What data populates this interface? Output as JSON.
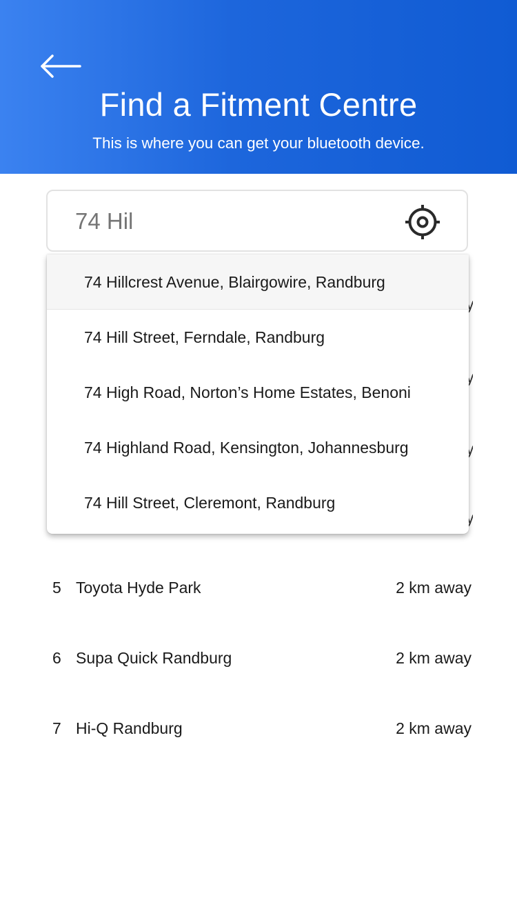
{
  "header": {
    "title": "Find a Fitment Centre",
    "subtitle": "This is where you can get your bluetooth device.",
    "gradient_colors": [
      "#3b82f0",
      "#105bd3"
    ],
    "back_icon": "arrow-left-icon"
  },
  "search": {
    "value": "",
    "placeholder": "74 Hil",
    "locate_icon": "crosshair-location-icon"
  },
  "suggestions": [
    "74 Hillcrest Avenue, Blairgowire, Randburg",
    "74 Hill Street, Ferndale, Randburg",
    "74 High Road, Norton’s Home Estates, Benoni",
    "74 Highland Road, Kensington, Johannesburg",
    "74 Hill Street, Cleremont, Randburg"
  ],
  "results": [
    {
      "index": "5",
      "name": "Toyota Hyde Park",
      "distance": "2 km away"
    },
    {
      "index": "6",
      "name": "Supa Quick Randburg",
      "distance": "2 km away"
    },
    {
      "index": "7",
      "name": "Hi-Q Randburg",
      "distance": "2 km away"
    }
  ]
}
